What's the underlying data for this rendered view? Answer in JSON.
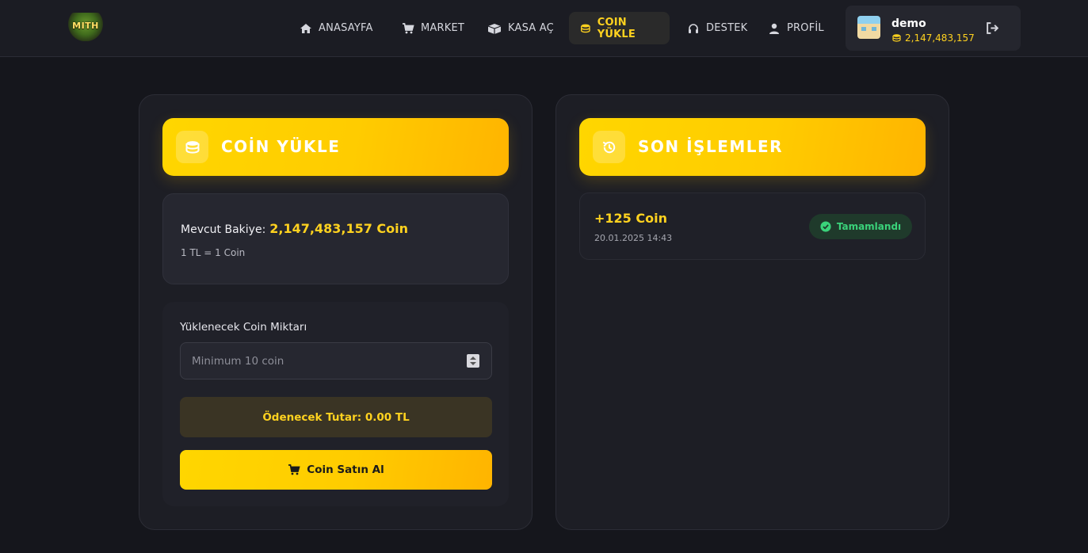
{
  "header": {
    "logo_text": "MITH",
    "nav": [
      {
        "label": "ANASAYFA",
        "icon": "home-icon"
      },
      {
        "label": "MARKET",
        "icon": "cart-icon"
      },
      {
        "label": "KASA AÇ",
        "icon": "box-icon"
      },
      {
        "label": "COIN YÜKLE",
        "icon": "coins-icon",
        "active": true
      },
      {
        "label": "DESTEK",
        "icon": "headset-icon"
      },
      {
        "label": "PROFİL",
        "icon": "user-icon"
      }
    ],
    "user": {
      "name": "demo",
      "balance": "2,147,483,157"
    }
  },
  "load_card": {
    "title": "COİN YÜKLE",
    "balance_label": "Mevcut Bakiye:",
    "balance_value": "2,147,483,157 Coin",
    "rate": "1 TL = 1 Coin",
    "amount_label": "Yüklenecek Coin Miktarı",
    "amount_placeholder": "Minimum 10 coin",
    "amount_value": "",
    "total_label": "Ödenecek Tutar: 0.00 TL",
    "buy_button": "Coin Satın Al"
  },
  "history_card": {
    "title": "SON İŞLEMLER",
    "transactions": [
      {
        "amount": "+125 Coin",
        "date": "20.01.2025 14:43",
        "status": "Tamamlandı"
      }
    ]
  },
  "colors": {
    "accent": "#ffd21f",
    "background": "#15161c",
    "success": "#3ad27a"
  }
}
